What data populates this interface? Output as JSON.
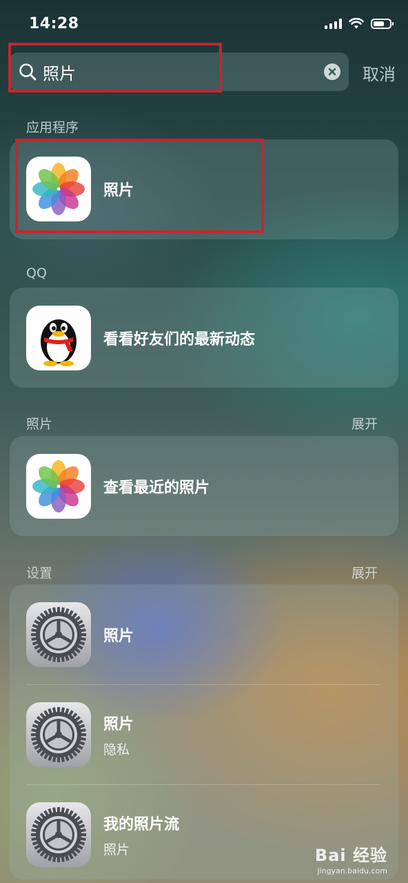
{
  "status_bar": {
    "time": "14:28",
    "battery_level": 0.7
  },
  "search": {
    "query": "照片",
    "placeholder": "",
    "cancel_label": "取消"
  },
  "sections": {
    "apps": {
      "label": "应用程序",
      "items": [
        {
          "title": "照片",
          "icon": "photos-icon"
        }
      ]
    },
    "qq": {
      "label": "QQ",
      "items": [
        {
          "title": "看看好友们的最新动态",
          "icon": "qq-penguin-icon"
        }
      ]
    },
    "photos": {
      "label": "照片",
      "expand": "展开",
      "items": [
        {
          "title": "查看最近的照片",
          "icon": "photos-icon"
        }
      ]
    },
    "settings": {
      "label": "设置",
      "expand": "展开",
      "items": [
        {
          "title": "照片",
          "subtitle": "",
          "icon": "settings-gear-icon"
        },
        {
          "title": "照片",
          "subtitle": "隐私",
          "icon": "settings-gear-icon"
        },
        {
          "title": "我的照片流",
          "subtitle": "照片",
          "icon": "settings-gear-icon"
        }
      ]
    }
  },
  "highlight_color": "#c8242f",
  "watermark": {
    "main": "Bai 经验",
    "sub": "jingyan.baidu.com"
  }
}
